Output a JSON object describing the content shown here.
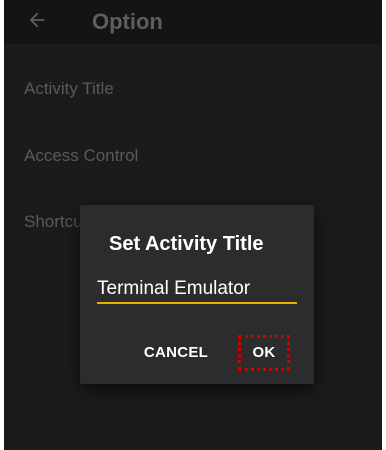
{
  "app_bar": {
    "title": "Option",
    "back_icon": "arrow-left-icon"
  },
  "preferences": [
    {
      "label": "Activity Title"
    },
    {
      "label": "Access Control"
    },
    {
      "label": "Shortcuts"
    }
  ],
  "dialog": {
    "title": "Set Activity Title",
    "input_value": "Terminal Emulator",
    "cancel_label": "CANCEL",
    "ok_label": "OK",
    "accent_color": "#e8b100",
    "highlight_color": "#d40000"
  }
}
